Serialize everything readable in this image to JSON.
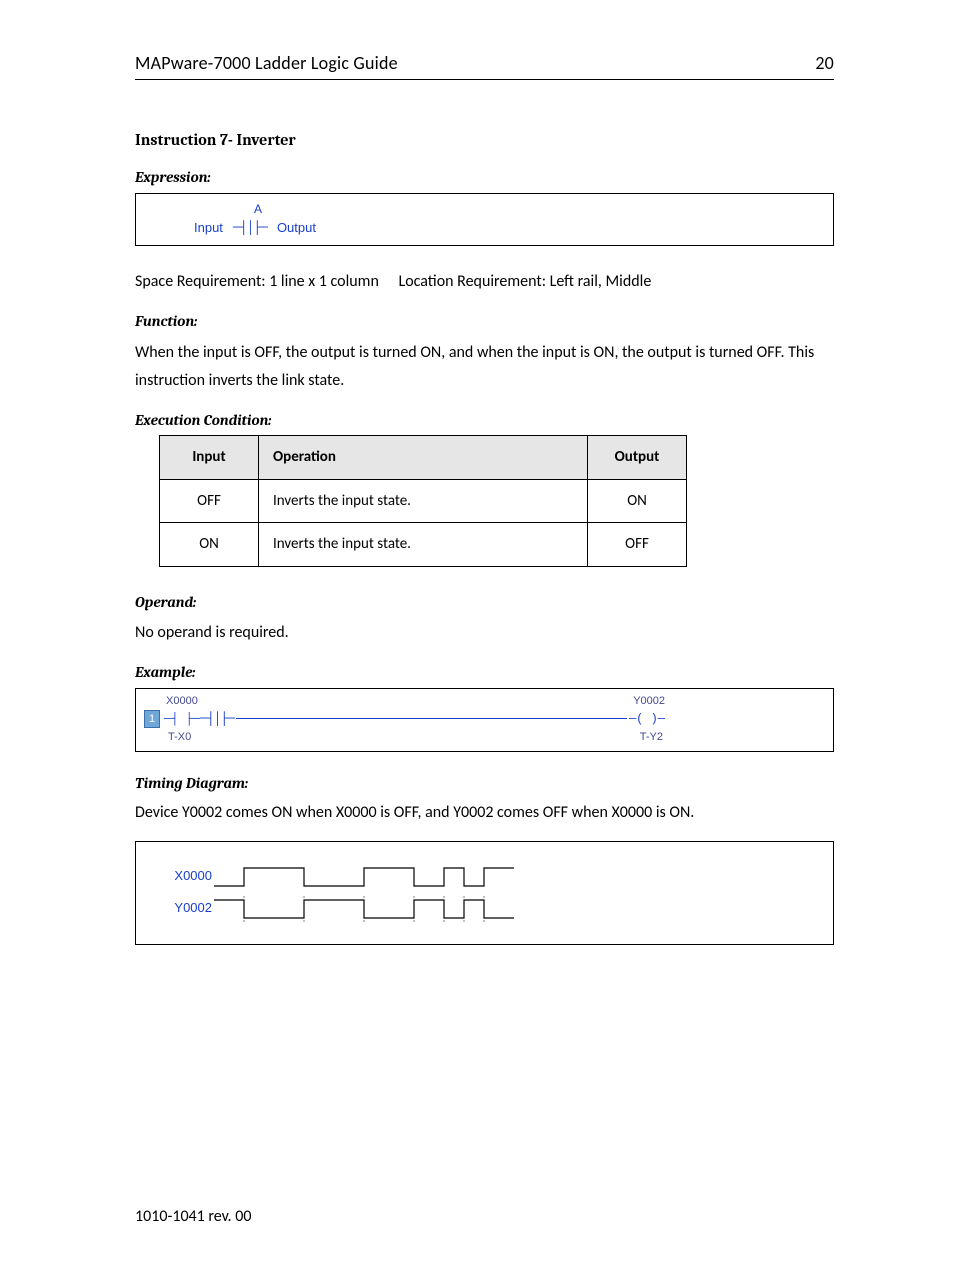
{
  "header": {
    "title": "MAPware-7000 Ladder Logic Guide",
    "page": "20"
  },
  "instruction": {
    "title": "Instruction 7- Inverter",
    "expression_label": "Expression:",
    "expr_operand": "A",
    "expr_input": "Input",
    "expr_output": "Output",
    "space_req": "Space Requirement: 1 line x 1 column  Location Requirement: Left rail, Middle",
    "function_label": "Function:",
    "function_text": "When the input is OFF, the output is turned ON, and when the input is ON, the output is turned OFF.  This instruction inverts the link state.",
    "exec_label": "Execution Condition:",
    "table": {
      "headers": [
        "Input",
        "Operation",
        "Output"
      ],
      "rows": [
        [
          "OFF",
          "Inverts the input state.",
          "ON"
        ],
        [
          "ON",
          "Inverts the input state.",
          "OFF"
        ]
      ]
    },
    "operand_label": "Operand:",
    "operand_text": "No operand is required.",
    "example_label": "Example:",
    "example": {
      "rung": "1",
      "left_top": "X0000",
      "left_bot": "T-X0",
      "right_top": "Y0002",
      "right_bot": "T-Y2"
    },
    "timing_label": "Timing Diagram:",
    "timing_text": "Device Y0002 comes ON when X0000 is OFF, and Y0002 comes OFF when X0000 is ON.",
    "timing": {
      "sig1": "X0000",
      "sig2": "Y0002"
    }
  },
  "footer": "1010-1041 rev. 00"
}
